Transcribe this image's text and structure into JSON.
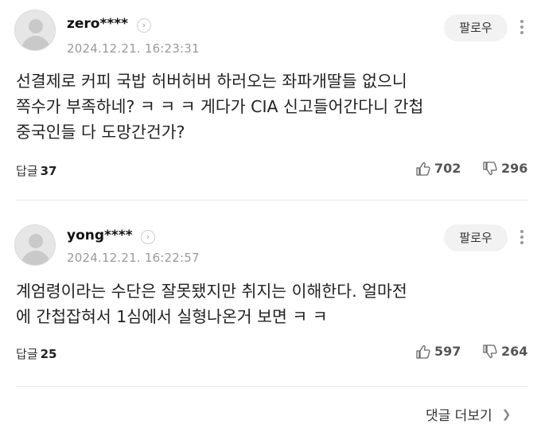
{
  "comments": [
    {
      "nickname": "zero****",
      "datetime": "2024.12.21. 16:23:31",
      "follow_label": "팔로우",
      "lines": [
        "선결제로 커피 국밥 허버허버 하러오는 좌파개딸들 없으니",
        "쪽수가 부족하네? ㅋ ㅋ ㅋ  게다가 CIA 신고들어간다니 간첩",
        "중국인들 다 도망간건가?"
      ],
      "replies_label": "답글",
      "replies_count": "37",
      "likes": "702",
      "dislikes": "296"
    },
    {
      "nickname": "yong****",
      "datetime": "2024.12.21. 16:22:57",
      "follow_label": "팔로우",
      "lines": [
        "계엄령이라는 수단은 잘못됐지만 취지는 이해한다. 얼마전",
        "에 간첩잡혀서 1심에서 실형나온거 보면  ㅋ ㅋ"
      ],
      "replies_label": "답글",
      "replies_count": "25",
      "likes": "597",
      "dislikes": "264"
    }
  ],
  "footer": {
    "more_comments_label": "댓글 더보기"
  },
  "icons": {
    "avatar": "default-avatar-icon",
    "profile_arrow": "chevron-right-circle-icon",
    "more": "more-vertical-icon",
    "like": "thumbs-up-icon",
    "dislike": "thumbs-down-icon",
    "footer_arrow": "chevron-right-icon"
  }
}
